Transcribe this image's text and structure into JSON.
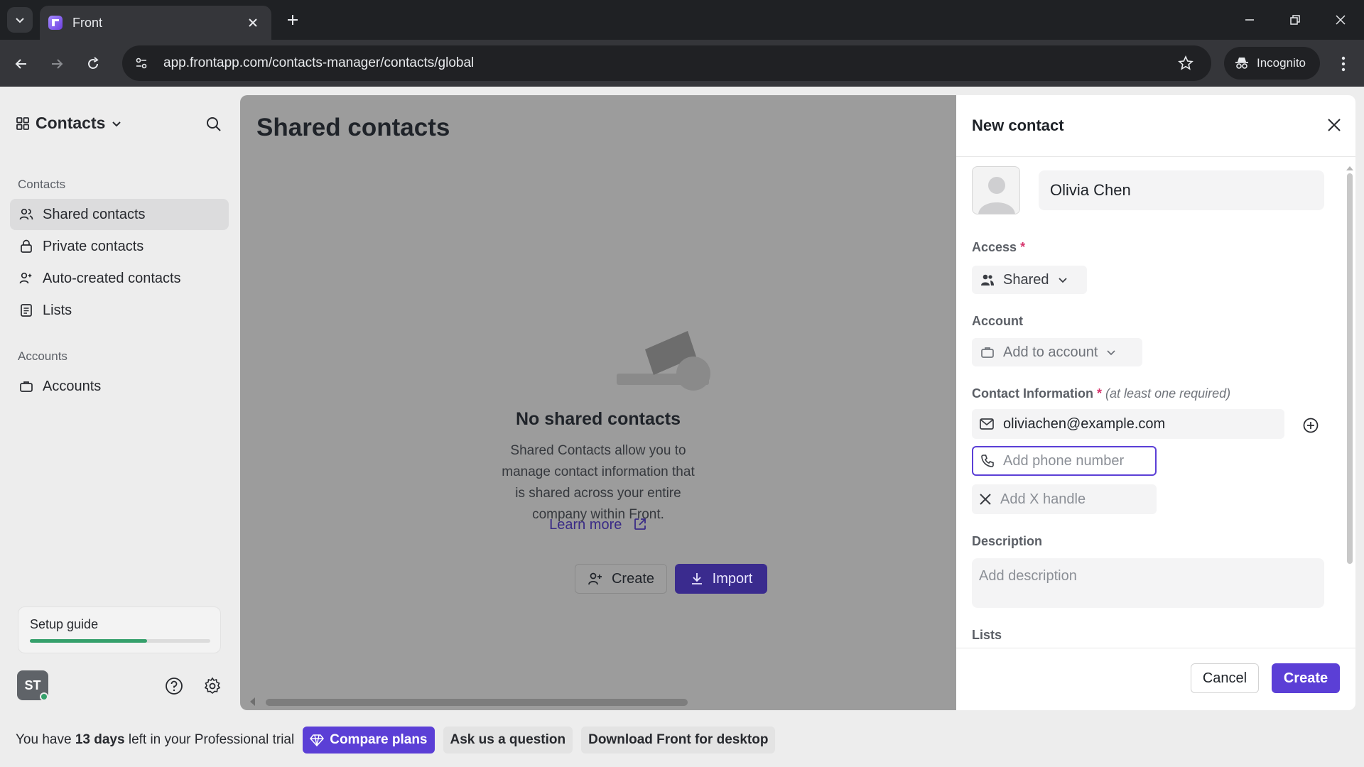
{
  "browser": {
    "tab_title": "Front",
    "url": "app.frontapp.com/contacts-manager/contacts/global",
    "incognito_label": "Incognito"
  },
  "sidebar": {
    "workspace": "Contacts",
    "contacts_heading": "Contacts",
    "items": [
      {
        "label": "Shared contacts",
        "icon": "people-icon",
        "active": true
      },
      {
        "label": "Private contacts",
        "icon": "lock-icon",
        "active": false
      },
      {
        "label": "Auto-created contacts",
        "icon": "auto-person-icon",
        "active": false
      },
      {
        "label": "Lists",
        "icon": "list-icon",
        "active": false
      }
    ],
    "accounts_heading": "Accounts",
    "accounts_item": "Accounts",
    "setup_guide": "Setup guide",
    "setup_progress": 0.65,
    "avatar_initials": "ST"
  },
  "main": {
    "title": "Shared contacts",
    "empty_title": "No shared contacts",
    "empty_text": "Shared Contacts allow you to manage contact information that is shared across your entire company within Front.",
    "learn_more": "Learn more",
    "create_label": "Create",
    "import_label": "Import"
  },
  "drawer": {
    "title": "New contact",
    "name_value": "Olivia Chen",
    "access_label": "Access",
    "access_value": "Shared",
    "account_label": "Account",
    "account_placeholder": "Add to account",
    "contact_info_label": "Contact Information",
    "contact_info_hint": "(at least one required)",
    "email_value": "oliviachen@example.com",
    "phone_placeholder": "Add phone number",
    "x_placeholder": "Add X handle",
    "description_label": "Description",
    "description_placeholder": "Add description",
    "lists_label": "Lists",
    "cancel_label": "Cancel",
    "create_label": "Create"
  },
  "trial": {
    "prefix": "You have ",
    "days": "13 days",
    "suffix": " left in your Professional trial",
    "compare_plans": "Compare plans",
    "ask_question": "Ask us a question",
    "download": "Download Front for desktop"
  },
  "colors": {
    "accent": "#5b3fd6",
    "progress": "#35a06b",
    "required": "#d6336c"
  }
}
